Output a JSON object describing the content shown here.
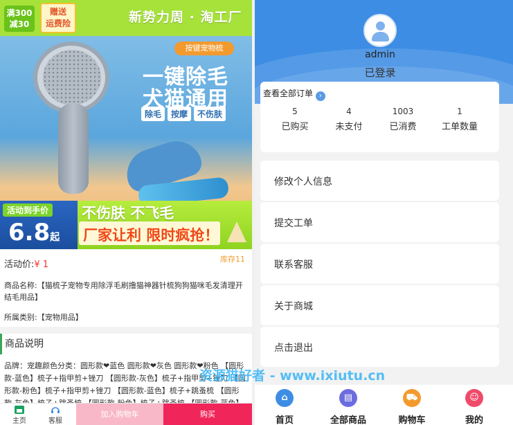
{
  "product_banner": {
    "badge_discount_line1": "满300",
    "badge_discount_line2": "减30",
    "badge_insurance_line1": "赠送",
    "badge_insurance_line2": "运费险",
    "brand_text": "新势力周 · 淘工厂",
    "feature_pill": "按键宠物梳",
    "headline_1": "一键除毛",
    "headline_2": "犬猫通用",
    "tags": [
      "除毛",
      "按摩",
      "不伤肤"
    ],
    "promo_tag": "活动到手价",
    "promo_price": "6.8",
    "promo_price_suffix": "起",
    "promo_line1": "不伤肤 不飞毛",
    "promo_line2": "厂家让利 限时疯抢！"
  },
  "product": {
    "price_label": "活动价:",
    "price_value": "¥ 1",
    "stock": "库存11",
    "name": "商品名称:【猫梳子宠物专用除浮毛刷撸猫神器针梳狗狗猫咪毛发清理开结毛用品】",
    "category": "所属类别:【宠物用品】",
    "description_title": "商品说明",
    "description_text": "品牌：宠趣颜色分类：圆形款❤蓝色 圆形款❤灰色 圆形款❤粉色 【圆形款-蓝色】梳子+指甲剪+锉刀 【圆形款-灰色】梳子+指甲剪+锉刀 【圆形款-粉色】梳子+指甲剪+锉刀 【圆形款-蓝色】梳子+跳蚤梳 【圆形款-灰色】梳子+跳蚤梳 【圆形款-粉色】梳子+跳蚤梳 【圆形款-蓝色】梳子+排"
  },
  "left_nav": {
    "home": "主页",
    "service": "客服",
    "add_cart": "加入购物车",
    "buy": "购买"
  },
  "profile": {
    "username": "admin",
    "status": "已登录",
    "all_orders": "查看全部订单",
    "stats": [
      {
        "value": "5",
        "label": "已购买"
      },
      {
        "value": "4",
        "label": "未支付"
      },
      {
        "value": "1003",
        "label": "已消费"
      },
      {
        "value": "1",
        "label": "工单数量"
      }
    ],
    "menu": [
      "修改个人信息",
      "提交工单",
      "联系客服",
      "关于商城",
      "点击退出"
    ]
  },
  "watermark": "资源猫好者 - www.ixiutu.cn",
  "right_nav": [
    {
      "label": "首页",
      "icon": "home-icon",
      "color": "#3d8de4"
    },
    {
      "label": "全部商品",
      "icon": "goods-icon",
      "color": "#6c6ce0"
    },
    {
      "label": "购物车",
      "icon": "cart-icon",
      "color": "#f39a2e"
    },
    {
      "label": "我的",
      "icon": "user-group-icon",
      "color": "#f04a6a"
    }
  ]
}
